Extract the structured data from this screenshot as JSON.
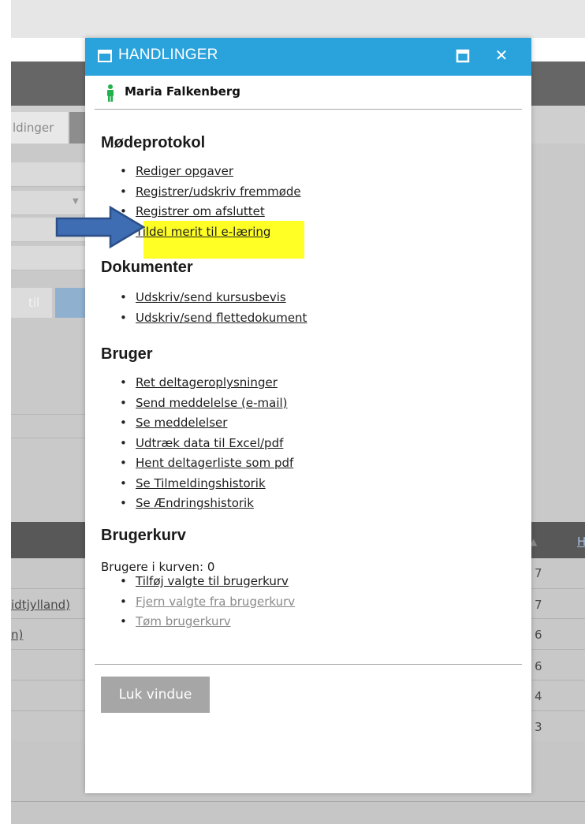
{
  "background": {
    "tab_label": "ldinger",
    "button_til": "til",
    "table_links": [
      "idtjylland)",
      "n)"
    ],
    "table_numbers": [
      "7",
      "7",
      "6",
      "6",
      "4",
      "3"
    ],
    "header_link": "H"
  },
  "dialog": {
    "title": "HANDLINGER",
    "user_name": "Maria Falkenberg",
    "sections": {
      "modeprotokol": {
        "heading": "Mødeprotokol",
        "items": [
          "Rediger opgaver",
          "Registrer/udskriv fremmøde",
          "Registrer om afsluttet",
          "Tildel merit til e-læring"
        ]
      },
      "dokumenter": {
        "heading": "Dokumenter",
        "items": [
          "Udskriv/send kursusbevis",
          "Udskriv/send flettedokument"
        ]
      },
      "bruger": {
        "heading": "Bruger",
        "items": [
          "Ret deltageroplysninger",
          "Send meddelelse (e-mail)",
          "Se meddelelser",
          "Udtræk data til Excel/pdf",
          "Hent deltagerliste som pdf",
          "Se Tilmeldingshistorik",
          "Se Ændringshistorik"
        ]
      },
      "brugerkurv": {
        "heading": "Brugerkurv",
        "count_text": "Brugere i kurven: 0",
        "items": [
          "Tilføj valgte til brugerkurv",
          "Fjern valgte fra brugerkurv",
          "Tøm brugerkurv"
        ]
      }
    },
    "close_button": "Luk vindue"
  },
  "colors": {
    "titlebar": "#2aa3dc",
    "highlight": "#ffff26",
    "arrow": "#3e6db3",
    "person_icon": "#22b14c"
  },
  "icons": {
    "window": "window-icon",
    "maximize": "maximize-icon",
    "close": "close-icon",
    "person": "person-icon",
    "annotation_arrow": "arrow-right-icon"
  }
}
